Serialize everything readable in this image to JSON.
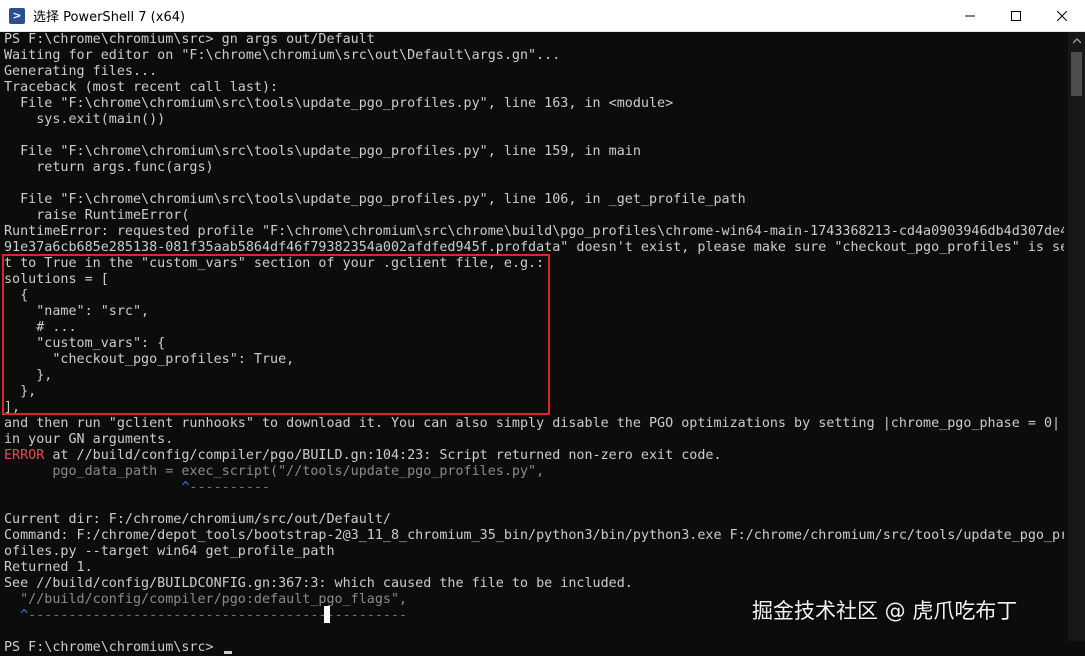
{
  "window": {
    "title": "选择 PowerShell 7 (x64)",
    "icon": "powershell-icon",
    "controls": [
      "minimize-icon",
      "maximize-icon",
      "close-icon"
    ]
  },
  "colors": {
    "background": "#0c0c0c",
    "text": "#cccccc",
    "error": "#e74856",
    "accent": "#3b78ff",
    "highlight_box": "#e0242e"
  },
  "console": {
    "lines": [
      "PS F:\\chrome\\chromium\\src> gn args out/Default",
      "Waiting for editor on \"F:\\chrome\\chromium\\src\\out\\Default\\args.gn\"...",
      "Generating files...",
      "Traceback (most recent call last):",
      "  File \"F:\\chrome\\chromium\\src\\tools\\update_pgo_profiles.py\", line 163, in <module>",
      "    sys.exit(main())",
      "",
      "  File \"F:\\chrome\\chromium\\src\\tools\\update_pgo_profiles.py\", line 159, in main",
      "    return args.func(args)",
      "",
      "  File \"F:\\chrome\\chromium\\src\\tools\\update_pgo_profiles.py\", line 106, in _get_profile_path",
      "    raise RuntimeError(",
      "RuntimeError: requested profile \"F:\\chrome\\chromium\\src\\chrome\\build\\pgo_profiles\\chrome-win64-main-1743368213-cd4a0903946db4d307de4",
      "91e37a6cb685e285138-081f35aab5864df46f79382354a002afdfed945f.profdata\" doesn't exist, please make sure \"checkout_pgo_profiles\" is se",
      "t to True in the \"custom_vars\" section of your .gclient file, e.g.:",
      "solutions = [",
      "  {",
      "    \"name\": \"src\",",
      "    # ...",
      "    \"custom_vars\": {",
      "      \"checkout_pgo_profiles\": True,",
      "    },",
      "  },",
      "],",
      "and then run \"gclient runhooks\" to download it. You can also simply disable the PGO optimizations by setting |chrome_pgo_phase = 0|",
      "in your GN arguments.",
      "at //build/config/compiler/pgo/BUILD.gn:104:23: Script returned non-zero exit code.",
      "      pgo_data_path = exec_script(\"//tools/update_pgo_profiles.py\",",
      "                      ^----------",
      "",
      "Current dir: F:/chrome/chromium/src/out/Default/",
      "Command: F:/chrome/depot_tools/bootstrap-2@3_11_8_chromium_35_bin/python3/bin/python3.exe F:/chrome/chromium/src/tools/update_pgo_pr",
      "ofiles.py --target win64 get_profile_path",
      "Returned 1.",
      "See //build/config/BUILDCONFIG.gn:367:3: which caused the file to be included.",
      "  \"//build/config/compiler/pgo:default_pgo_flags\",",
      "  ^-----------------------------------------------",
      "",
      "PS F:\\chrome\\chromium\\src> "
    ],
    "error_label": "ERROR"
  },
  "watermark": "掘金技术社区 @ 虎爪吃布丁"
}
